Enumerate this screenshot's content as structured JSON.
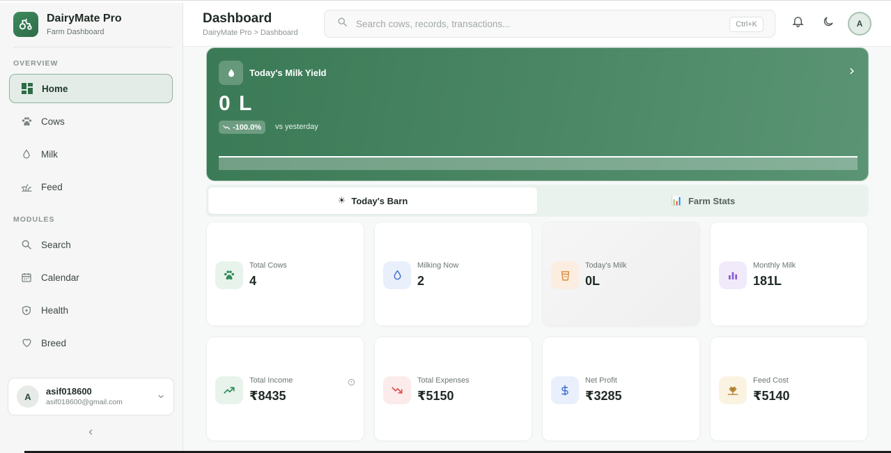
{
  "app": {
    "name": "DairyMate Pro",
    "subtitle": "Farm Dashboard"
  },
  "sidebar": {
    "overview_label": "OVERVIEW",
    "modules_label": "MODULES",
    "overview_items": [
      {
        "label": "Home",
        "icon": "dashboard-icon",
        "active": true
      },
      {
        "label": "Cows",
        "icon": "paw-icon"
      },
      {
        "label": "Milk",
        "icon": "drop-icon"
      },
      {
        "label": "Feed",
        "icon": "grass-icon"
      }
    ],
    "module_items": [
      {
        "label": "Search",
        "icon": "search-icon"
      },
      {
        "label": "Calendar",
        "icon": "calendar-icon"
      },
      {
        "label": "Health",
        "icon": "shield-plus-icon"
      },
      {
        "label": "Breed",
        "icon": "heart-icon"
      }
    ],
    "user": {
      "initial": "A",
      "name": "asif018600",
      "email": "asif018600@gmail.com"
    }
  },
  "header": {
    "title": "Dashboard",
    "breadcrumb": "DairyMate Pro > Dashboard",
    "search_placeholder": "Search cows, records, transactions...",
    "search_shortcut": "Ctrl+K",
    "avatar_initial": "A"
  },
  "hero": {
    "title": "Today's Milk Yield",
    "value": "0 L",
    "change": "-100.0%",
    "change_caption": "vs yesterday"
  },
  "tabs": [
    {
      "label": "Today's Barn",
      "icon": "☀",
      "active": true
    },
    {
      "label": "Farm Stats",
      "icon": "📊",
      "active": false
    }
  ],
  "stats": [
    {
      "label": "Total Cows",
      "value": "4",
      "icon": "paw-icon"
    },
    {
      "label": "Milking Now",
      "value": "2",
      "icon": "drop-icon"
    },
    {
      "label": "Today's Milk",
      "value": "0L",
      "icon": "cup-icon"
    },
    {
      "label": "Monthly Milk",
      "value": "181L",
      "icon": "bar-chart-icon"
    },
    {
      "label": "Total Income",
      "value": "₹8435",
      "icon": "trending-up-icon"
    },
    {
      "label": "Total Expenses",
      "value": "₹5150",
      "icon": "trending-down-icon"
    },
    {
      "label": "Net Profit",
      "value": "₹3285",
      "icon": "dollar-icon"
    },
    {
      "label": "Feed Cost",
      "value": "₹5140",
      "icon": "wheat-icon"
    }
  ],
  "colors": {
    "accent": "#3b7a56",
    "income": "#2f8a58",
    "expense": "#d9534f",
    "profit": "#3b6fd0",
    "milk": "#e08a3c",
    "monthly": "#8a5ad0",
    "feed": "#b07a28"
  }
}
